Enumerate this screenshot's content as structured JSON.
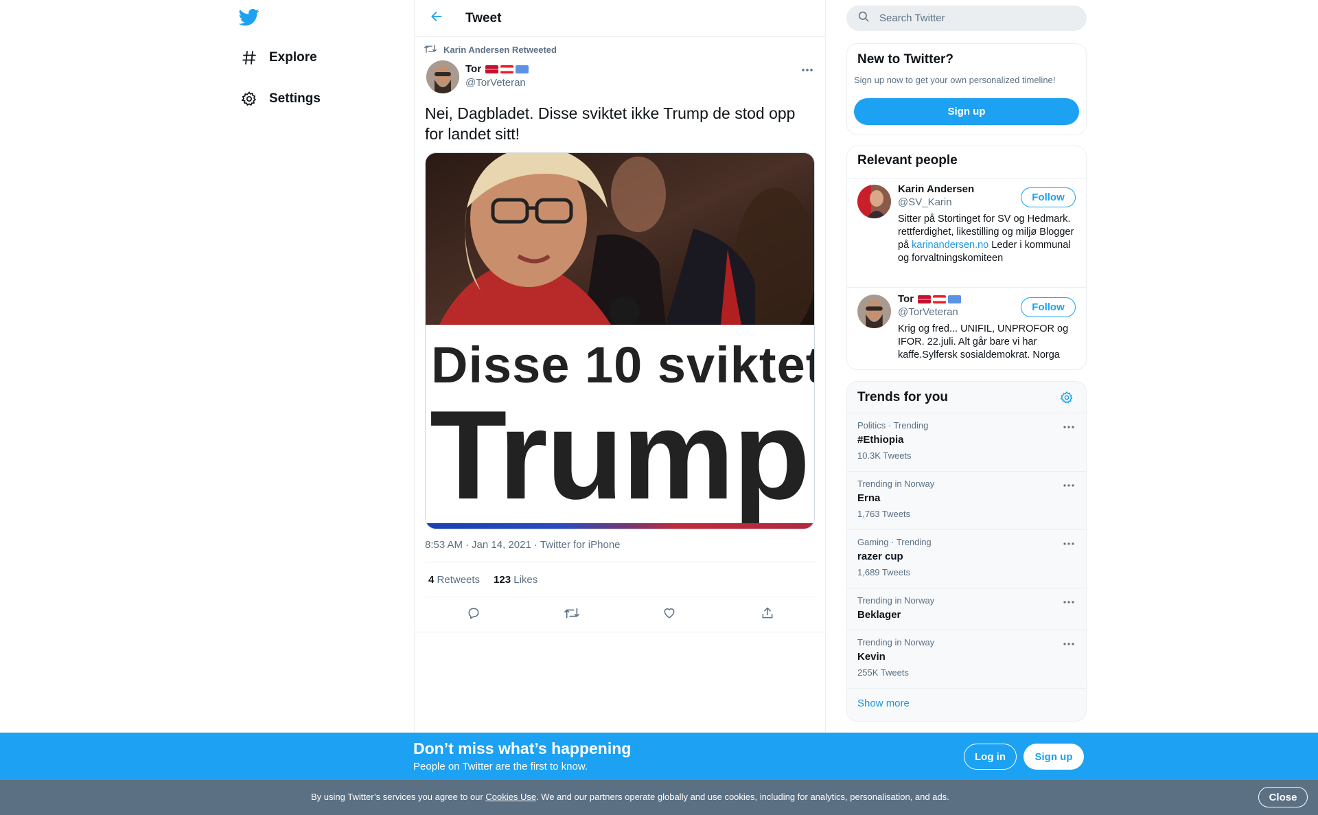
{
  "nav": {
    "explore_label": "Explore",
    "settings_label": "Settings"
  },
  "header": {
    "title": "Tweet"
  },
  "tweet": {
    "retweeted_by": "Karin Andersen Retweeted",
    "author_name": "Tor",
    "author_handle": "@TorVeteran",
    "text": "Nei, Dagbladet. Disse sviktet ikke Trump de stod opp for landet sitt!",
    "media_headline_1": "Disse 10 sviktet",
    "media_headline_2": "Trump",
    "time": "8:53 AM",
    "date": "Jan 14, 2021",
    "source": "Twitter for iPhone",
    "retweets_count": "4",
    "retweets_label": "Retweets",
    "likes_count": "123",
    "likes_label": "Likes"
  },
  "search": {
    "placeholder": "Search Twitter"
  },
  "new_to_twitter": {
    "title": "New to Twitter?",
    "subtitle": "Sign up now to get your own personalized timeline!",
    "signup_label": "Sign up"
  },
  "relevant_people": {
    "title": "Relevant people",
    "people": [
      {
        "name": "Karin Andersen",
        "handle": "@SV_Karin",
        "follow_label": "Follow",
        "bio_before_link": "Sitter på Stortinget for SV og Hedmark. rettferdighet, likestilling og miljø Blogger på ",
        "bio_link": "karinandersen.no",
        "bio_after_link": " Leder i kommunal og forvaltningskomiteen"
      },
      {
        "name": "Tor",
        "handle": "@TorVeteran",
        "follow_label": "Follow",
        "bio": "Krig og fred... UNIFIL, UNPROFOR og IFOR. 22.juli. Alt går bare vi har kaffe.Sylfersk sosialdemokrat. Norga"
      }
    ]
  },
  "trends": {
    "title": "Trends for you",
    "items": [
      {
        "category": "Politics · Trending",
        "name": "#Ethiopia",
        "count": "10.3K Tweets"
      },
      {
        "category": "Trending in Norway",
        "name": "Erna",
        "count": "1,763 Tweets"
      },
      {
        "category": "Gaming · Trending",
        "name": "razer cup",
        "count": "1,689 Tweets"
      },
      {
        "category": "Trending in Norway",
        "name": "Beklager",
        "count": ""
      },
      {
        "category": "Trending in Norway",
        "name": "Kevin",
        "count": "255K Tweets"
      }
    ],
    "show_more_label": "Show more"
  },
  "bottom_bar": {
    "title": "Don’t miss what’s happening",
    "subtitle": "People on Twitter are the first to know.",
    "login_label": "Log in",
    "signup_label": "Sign up"
  },
  "cookie": {
    "text_before": "By using Twitter’s services you agree to our ",
    "link": "Cookies Use",
    "text_after": ". We and our partners operate globally and use cookies, including for analytics, personalisation, and ads.",
    "close_label": "Close"
  },
  "colors": {
    "brand": "#1da1f2",
    "link": "#1b95e0",
    "secondary_text": "#5b7083",
    "cookie_bar": "#5b7083"
  },
  "icons": {
    "logo": "twitter-bird-icon",
    "explore": "hashtag-icon",
    "settings": "gear-icon",
    "back": "arrow-left-icon",
    "retweet": "retweet-icon",
    "more": "more-dots-icon",
    "reply": "reply-icon",
    "like": "heart-icon",
    "share": "share-icon",
    "search": "search-icon"
  }
}
